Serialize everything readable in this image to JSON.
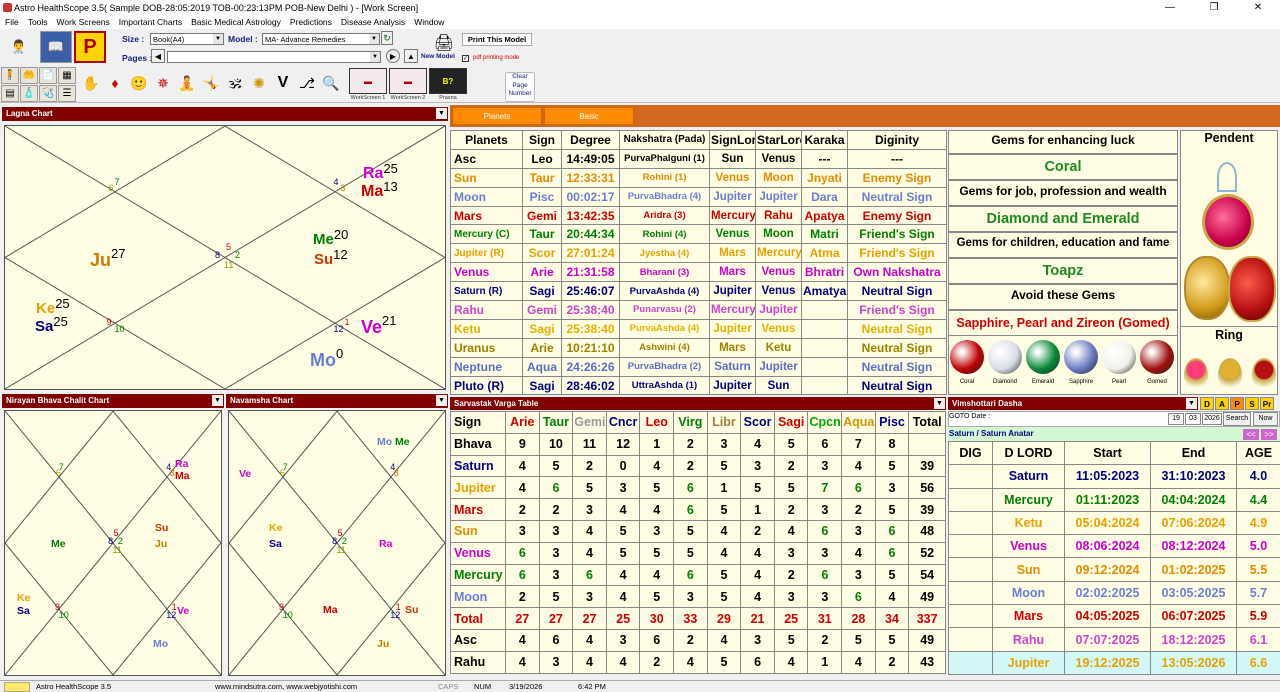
{
  "window": {
    "title": "Astro HealthScope 3.5( Sample DOB-28:05:2019 TOB-00:23:13PM POB-New Delhi ) - [Work Screen]",
    "min": "—",
    "max": "❐",
    "close": "✕"
  },
  "menu": [
    "File",
    "Tools",
    "Work Screens",
    "Important Charts",
    "Basic Medical Astrology",
    "Predictions",
    "Disease Analysis",
    "Window"
  ],
  "toolbar": {
    "size_label": "Size :",
    "size_value": "Book(A4)",
    "model_label": "Model :",
    "model_value": "MA- Advance Remedies",
    "pages_label": "Pages :",
    "print_label": "Print This Model",
    "new_model": "New Model",
    "pdf_mode": "pdf printing mode",
    "clear_page": [
      "Clear",
      "Page",
      "Number"
    ],
    "ws1": "WorkScreen 1",
    "ws2": "WorkScreen 2",
    "prasna": "Prasna",
    "p_letter": "P",
    "v_letter": "V"
  },
  "lagna": {
    "title": "Lagna Chart",
    "houses": [
      "7",
      "6",
      "4",
      "3",
      "5",
      "8",
      "2",
      "11",
      "9",
      "10",
      "12",
      "1"
    ],
    "planets": [
      {
        "t": "Ra",
        "d": "25",
        "c": "#cc00cc"
      },
      {
        "t": "Ma",
        "d": "13",
        "c": "#cc0000"
      },
      {
        "t": "Ju",
        "d": "27",
        "c": "#cc7a00"
      },
      {
        "t": "Me",
        "d": "20",
        "c": "#008000"
      },
      {
        "t": "Su",
        "d": "12",
        "c": "#cc3300"
      },
      {
        "t": "Ke",
        "d": "25",
        "c": "#e6a000"
      },
      {
        "t": "Sa",
        "d": "25",
        "c": "#000080"
      },
      {
        "t": "Ve",
        "d": "21",
        "c": "#cc00cc"
      },
      {
        "t": "Mo",
        "d": "0",
        "c": "#6a7fd4"
      }
    ]
  },
  "bhava": {
    "title": "Nirayan Bhava Chalit Chart",
    "houses": [
      "7",
      "6",
      "4",
      "3",
      "5",
      "8",
      "2",
      "11",
      "9",
      "10",
      "12",
      "1"
    ],
    "planets": [
      {
        "t": "Ra",
        "c": "#cc00cc"
      },
      {
        "t": "Ma",
        "c": "#cc0000"
      },
      {
        "t": "Me",
        "c": "#008000"
      },
      {
        "t": "Su",
        "c": "#cc3300"
      },
      {
        "t": "Ju",
        "c": "#cc7a00"
      },
      {
        "t": "Ke",
        "c": "#e6a000"
      },
      {
        "t": "Sa",
        "c": "#000080"
      },
      {
        "t": "Ve",
        "c": "#cc00cc"
      },
      {
        "t": "Mo",
        "c": "#6a7fd4"
      }
    ]
  },
  "navamsha": {
    "title": "Navamsha Chart",
    "houses": [
      "7",
      "6",
      "4",
      "3",
      "5",
      "8",
      "2",
      "11",
      "9",
      "10",
      "12",
      "1"
    ],
    "planets": [
      {
        "t": "Mo",
        "c": "#6a7fd4"
      },
      {
        "t": "Me",
        "c": "#008000"
      },
      {
        "t": "Ve",
        "c": "#cc00cc"
      },
      {
        "t": "Ke",
        "c": "#e6a000"
      },
      {
        "t": "Sa",
        "c": "#000080"
      },
      {
        "t": "Ra",
        "c": "#cc00cc"
      },
      {
        "t": "Ma",
        "c": "#cc0000"
      },
      {
        "t": "Su",
        "c": "#cc3300"
      },
      {
        "t": "Ju",
        "c": "#cc7a00"
      }
    ]
  },
  "tabs": [
    "Planets",
    "Basic"
  ],
  "planets_table": {
    "headers": [
      "Planets",
      "Sign",
      "Degree",
      "Nakshatra (Pada)",
      "SignLord",
      "StarLord",
      "Karaka",
      "Diginity"
    ],
    "rows": [
      {
        "c": "#000000",
        "v": [
          "Asc",
          "Leo",
          "14:49:05",
          "PurvaPhalguni (1)",
          "Sun",
          "Venus",
          "---",
          "---"
        ]
      },
      {
        "c": "#e68a00",
        "v": [
          "Sun",
          "Taur",
          "12:33:31",
          "Rohini (1)",
          "Venus",
          "Moon",
          "Jnyati",
          "Enemy Sign"
        ]
      },
      {
        "c": "#6a7fd4",
        "v": [
          "Moon",
          "Pisc",
          "00:02:17",
          "PurvaBhadra (4)",
          "Jupiter",
          "Jupiter",
          "Dara",
          "Neutral Sign"
        ]
      },
      {
        "c": "#cc0000",
        "v": [
          "Mars",
          "Gemi",
          "13:42:35",
          "Aridra (3)",
          "Mercury",
          "Rahu",
          "Apatya",
          "Enemy Sign"
        ]
      },
      {
        "c": "#008000",
        "v": [
          "Mercury (C)",
          "Taur",
          "20:44:34",
          "Rohini (4)",
          "Venus",
          "Moon",
          "Matri",
          "Friend's Sign"
        ]
      },
      {
        "c": "#e6a000",
        "v": [
          "Jupiter (R)",
          "Scor",
          "27:01:24",
          "Jyestha (4)",
          "Mars",
          "Mercury",
          "Atma",
          "Friend's Sign"
        ]
      },
      {
        "c": "#cc00cc",
        "v": [
          "Venus",
          "Arie",
          "21:31:58",
          "Bharani (3)",
          "Mars",
          "Venus",
          "Bhratri",
          "Own Nakshatra"
        ]
      },
      {
        "c": "#000080",
        "v": [
          "Saturn (R)",
          "Sagi",
          "25:46:07",
          "PurvaAshda (4)",
          "Jupiter",
          "Venus",
          "Amatya",
          "Neutral Sign"
        ]
      },
      {
        "c": "#cc44cc",
        "v": [
          "Rahu",
          "Gemi",
          "25:38:40",
          "Punarvasu (2)",
          "Mercury",
          "Jupiter",
          "",
          "Friend's Sign"
        ]
      },
      {
        "c": "#e6b000",
        "v": [
          "Ketu",
          "Sagi",
          "25:38:40",
          "PurvaAshda (4)",
          "Jupiter",
          "Venus",
          "",
          "Neutral Sign"
        ]
      },
      {
        "c": "#a08000",
        "v": [
          "Uranus",
          "Arie",
          "10:21:10",
          "Ashwini (4)",
          "Mars",
          "Ketu",
          "",
          "Neutral Sign"
        ]
      },
      {
        "c": "#5a6fc4",
        "v": [
          "Neptune",
          "Aqua",
          "24:26:26",
          "PurvaBhadra (2)",
          "Saturn",
          "Jupiter",
          "",
          "Neutral Sign"
        ]
      },
      {
        "c": "#000080",
        "v": [
          "Pluto (R)",
          "Sagi",
          "28:46:02",
          "UttraAshda (1)",
          "Jupiter",
          "Sun",
          "",
          "Neutral Sign"
        ]
      }
    ]
  },
  "gems": {
    "luck_title": "Gems for enhancing luck",
    "luck": "Coral",
    "job_title": "Gems for job, profession and wealth",
    "job": "Diamond and Emerald",
    "child_title": "Gems for children, education and fame",
    "child": "Toapz",
    "avoid_title": "Avoid these Gems",
    "avoid": "Sapphire, Pearl and Zireon (Gomed)",
    "stones": [
      {
        "n": "Coral",
        "c": "#c00000"
      },
      {
        "n": "Diamond",
        "c": "#d8dde6"
      },
      {
        "n": "Emerald",
        "c": "#0a8a3a"
      },
      {
        "n": "Sapphire",
        "c": "#6b7bc0"
      },
      {
        "n": "Pearl",
        "c": "#f1f1ea"
      },
      {
        "n": "Gomed",
        "c": "#a01010"
      }
    ],
    "pendent": "Pendent",
    "ring": "Ring"
  },
  "varga": {
    "title": "Sarvastak Varga Table",
    "headers": [
      {
        "t": "Sign",
        "c": "#000000"
      },
      {
        "t": "Arie",
        "c": "#cc0000"
      },
      {
        "t": "Taur",
        "c": "#008000"
      },
      {
        "t": "Gemi",
        "c": "#999999"
      },
      {
        "t": "Cncr",
        "c": "#000080"
      },
      {
        "t": "Leo",
        "c": "#cc0000"
      },
      {
        "t": "Virg",
        "c": "#008000"
      },
      {
        "t": "Libr",
        "c": "#a08040"
      },
      {
        "t": "Scor",
        "c": "#000080"
      },
      {
        "t": "Sagi",
        "c": "#cc0000"
      },
      {
        "t": "Cpcn",
        "c": "#00aa00"
      },
      {
        "t": "Aqua",
        "c": "#cc9900"
      },
      {
        "t": "Pisc",
        "c": "#000080"
      },
      {
        "t": "Total",
        "c": "#000000"
      }
    ],
    "rows": [
      {
        "n": "Bhava",
        "c": "#000000",
        "v": [
          "9",
          "10",
          "11",
          "12",
          "1",
          "2",
          "3",
          "4",
          "5",
          "6",
          "7",
          "8",
          ""
        ]
      },
      {
        "n": "Saturn",
        "c": "#000080",
        "v": [
          "4",
          "5",
          "2",
          "0",
          "4",
          "2",
          "5",
          "3",
          "2",
          "3",
          "4",
          "5",
          "39"
        ]
      },
      {
        "n": "Jupiter",
        "c": "#e6a000",
        "v": [
          "4",
          "6",
          "5",
          "3",
          "5",
          "6",
          "1",
          "5",
          "5",
          "7",
          "6",
          "3",
          "56"
        ]
      },
      {
        "n": "Mars",
        "c": "#cc0000",
        "v": [
          "2",
          "2",
          "3",
          "4",
          "4",
          "6",
          "5",
          "1",
          "2",
          "3",
          "2",
          "5",
          "39"
        ]
      },
      {
        "n": "Sun",
        "c": "#e68a00",
        "v": [
          "3",
          "3",
          "4",
          "5",
          "3",
          "5",
          "4",
          "2",
          "4",
          "6",
          "3",
          "6",
          "48"
        ]
      },
      {
        "n": "Venus",
        "c": "#cc00cc",
        "v": [
          "6",
          "3",
          "4",
          "5",
          "5",
          "5",
          "4",
          "4",
          "3",
          "3",
          "4",
          "6",
          "52"
        ]
      },
      {
        "n": "Mercury",
        "c": "#008000",
        "v": [
          "6",
          "3",
          "6",
          "4",
          "4",
          "6",
          "5",
          "4",
          "2",
          "6",
          "3",
          "5",
          "54"
        ]
      },
      {
        "n": "Moon",
        "c": "#6a7fd4",
        "v": [
          "2",
          "5",
          "3",
          "4",
          "5",
          "3",
          "5",
          "4",
          "3",
          "3",
          "6",
          "4",
          "49"
        ]
      },
      {
        "n": "Total",
        "c": "#cc0000",
        "v": [
          "27",
          "27",
          "27",
          "25",
          "30",
          "33",
          "29",
          "21",
          "25",
          "31",
          "28",
          "34",
          "337"
        ]
      },
      {
        "n": "Asc",
        "c": "#000000",
        "v": [
          "4",
          "6",
          "4",
          "3",
          "6",
          "2",
          "4",
          "3",
          "5",
          "2",
          "5",
          "5",
          "49"
        ]
      },
      {
        "n": "Rahu",
        "c": "#000000",
        "v": [
          "4",
          "3",
          "4",
          "4",
          "2",
          "4",
          "5",
          "6",
          "4",
          "1",
          "4",
          "2",
          "43"
        ]
      }
    ]
  },
  "dasha": {
    "title": "Vimshottari Dasha",
    "btns": [
      "D",
      "A",
      "P",
      "S",
      "Pr"
    ],
    "goto": "GOTO Date :",
    "gd": "19",
    "gm": "03",
    "gy": "2026",
    "search": "Search",
    "now": "Now",
    "current": "Saturn / Saturn Anatar",
    "prev": "<<",
    "next": ">>",
    "headers": [
      "DIG",
      "D LORD",
      "Start",
      "End",
      "AGE"
    ],
    "rows": [
      {
        "c": "#000080",
        "v": [
          "",
          "Saturn",
          "11:05:2023",
          "31:10:2023",
          "4.0"
        ]
      },
      {
        "c": "#008000",
        "v": [
          "",
          "Mercury",
          "01:11:2023",
          "04:04:2024",
          "4.4"
        ]
      },
      {
        "c": "#e6a000",
        "v": [
          "",
          "Ketu",
          "05:04:2024",
          "07:06:2024",
          "4.9"
        ]
      },
      {
        "c": "#cc00cc",
        "v": [
          "",
          "Venus",
          "08:06:2024",
          "08:12:2024",
          "5.0"
        ]
      },
      {
        "c": "#e68a00",
        "v": [
          "",
          "Sun",
          "09:12:2024",
          "01:02:2025",
          "5.5"
        ]
      },
      {
        "c": "#6a7fd4",
        "v": [
          "",
          "Moon",
          "02:02:2025",
          "03:05:2025",
          "5.7"
        ]
      },
      {
        "c": "#cc0000",
        "v": [
          "",
          "Mars",
          "04:05:2025",
          "06:07:2025",
          "5.9"
        ]
      },
      {
        "c": "#cc44cc",
        "v": [
          "",
          "Rahu",
          "07:07:2025",
          "18:12:2025",
          "6.1"
        ]
      },
      {
        "c": "#e6a000",
        "v": [
          "",
          "Jupiter",
          "19:12:2025",
          "13:05:2026",
          "6.6"
        ]
      }
    ]
  },
  "status": {
    "app": "Astro HealthScope 3.5",
    "url": "www.mindsutra.com, www.webjyotishi.com",
    "caps": "CAPS",
    "num": "NUM",
    "date": "3/19/2026",
    "time": "6:42 PM"
  }
}
